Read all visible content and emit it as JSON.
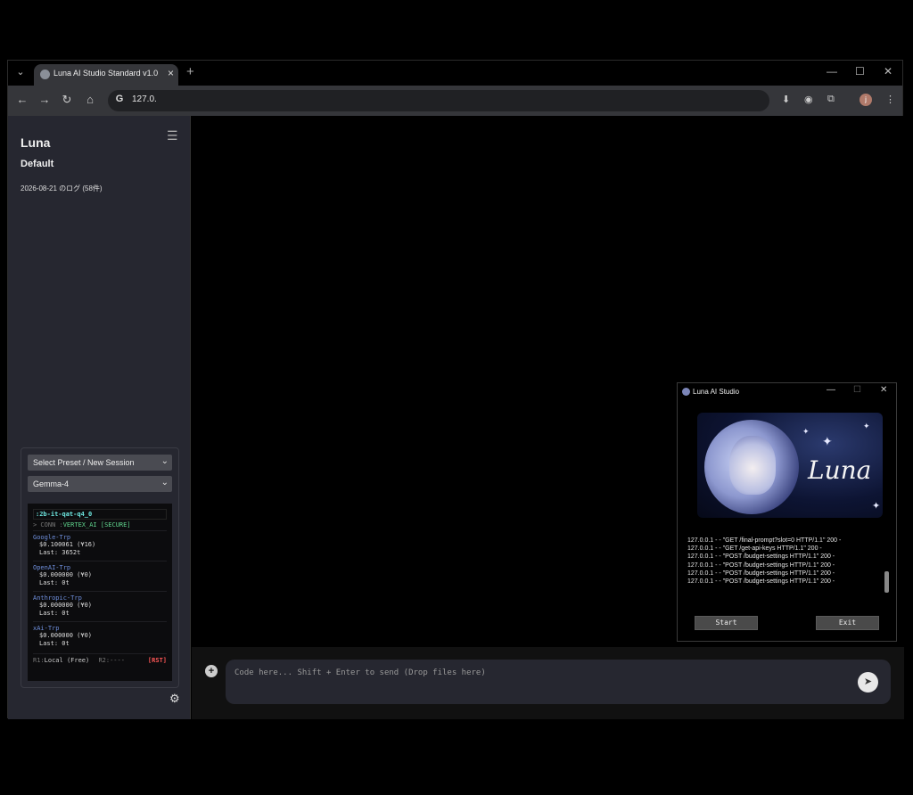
{
  "browser": {
    "tab_title": "Luna AI Studio Standard v1.0",
    "url": "127.0."
  },
  "sidebar": {
    "title": "Luna",
    "subtitle": "Default",
    "log_entry": "2026-08-21 のログ (58件)",
    "preset_select": "Select Preset / New Session",
    "model_select": "Gemma-4"
  },
  "terminal": {
    "model_id": ":2b-it-qat-q4_0",
    "conn_label": "> CONN :",
    "conn_value": "VERTEX_AI [SECURE]",
    "providers": [
      {
        "name": "Google-Trp",
        "cost": "$0.100061 (¥16)",
        "last": "Last: 3652t"
      },
      {
        "name": "OpenAI-Trp",
        "cost": "$0.000000 (¥0)",
        "last": "Last: 0t"
      },
      {
        "name": "Anthropic-Trp",
        "cost": "$0.000000 (¥0)",
        "last": "Last: 0t"
      },
      {
        "name": "xAi-Trp",
        "cost": "$0.000000 (¥0)",
        "last": "Last: 0t"
      }
    ],
    "r1_label": "R1:",
    "r1_value": "Local (Free)",
    "r2_label": "R2:----",
    "reset": "[RST]"
  },
  "composer": {
    "placeholder": "Code here... Shift + Enter to send (Drop files here)"
  },
  "app_window": {
    "title": "Luna AI Studio",
    "brand": "Luna",
    "log_lines": [
      "127.0.0.1 - - \"GET /final-prompt?slot=0 HTTP/1.1\" 200 -",
      "127.0.0.1 - - \"GET /get-api-keys HTTP/1.1\" 200 -",
      "127.0.0.1 - - \"POST /budget-settings HTTP/1.1\" 200 -",
      "127.0.0.1 - - \"POST /budget-settings HTTP/1.1\" 200 -",
      "127.0.0.1 - - \"POST /budget-settings HTTP/1.1\" 200 -",
      "127.0.0.1 - - \"POST /budget-settings HTTP/1.1\" 200 -"
    ],
    "start_label": "Start",
    "exit_label": "Exit"
  },
  "icons": [
    "tab-list-icon",
    "favicon-icon",
    "close-icon",
    "new-tab-icon",
    "minimize-icon",
    "maximize-icon",
    "back-icon",
    "forward-icon",
    "reload-icon",
    "home-icon",
    "google-icon",
    "download-icon",
    "record-icon",
    "extensions-icon",
    "menu-icon",
    "hamburger-icon",
    "gear-icon",
    "plus-icon",
    "send-icon"
  ]
}
